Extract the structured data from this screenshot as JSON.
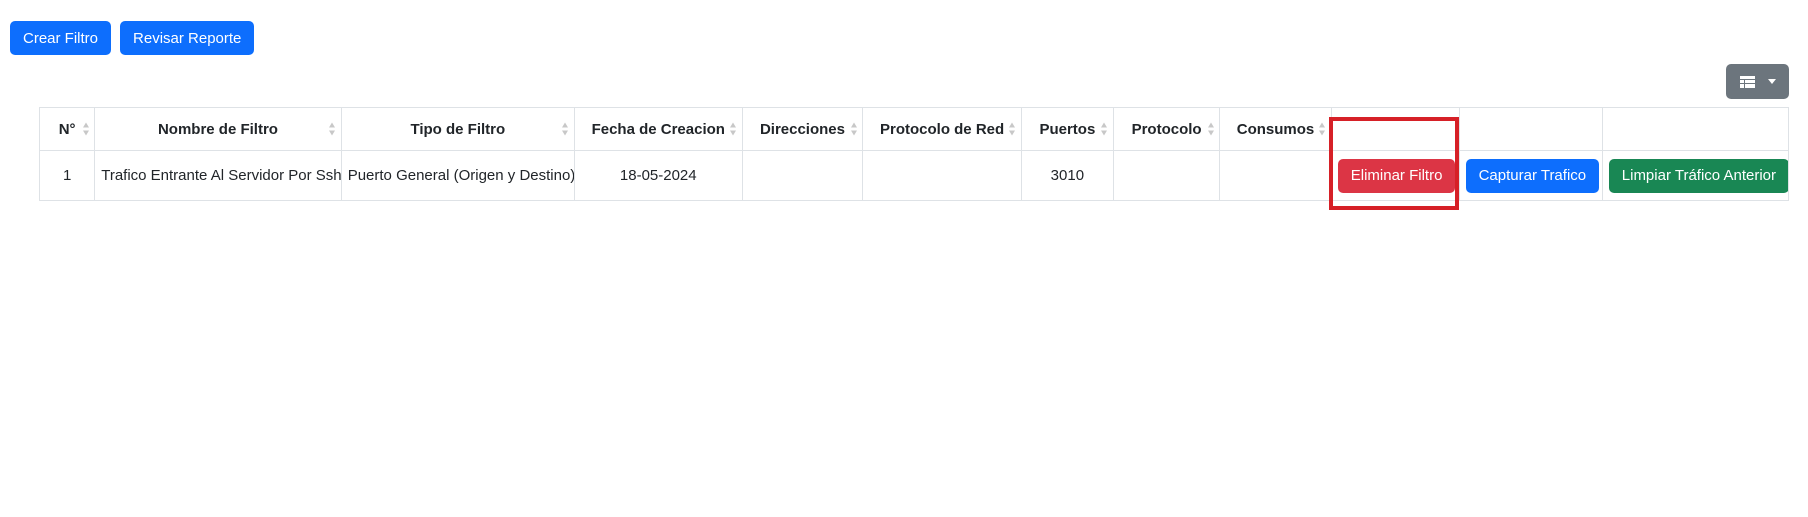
{
  "toolbar": {
    "create_filter_label": "Crear Filtro",
    "review_report_label": "Revisar Reporte"
  },
  "columns_toggle": {
    "icon": "grid-icon",
    "caret": "caret-down-icon",
    "color": "#6c757d"
  },
  "table": {
    "headers": [
      "N°",
      "Nombre de Filtro",
      "Tipo de Filtro",
      "Fecha de Creacion",
      "Direcciones",
      "Protocolo de Red",
      "Puertos",
      "Protocolo",
      "Consumos",
      "",
      "",
      ""
    ],
    "rows": [
      {
        "number": "1",
        "name": "Trafico Entrante Al Servidor Por Ssh",
        "type": "Puerto General (Origen y Destino)",
        "date": "18-05-2024",
        "addresses": "",
        "network_protocol": "",
        "ports": "3010",
        "protocol": "",
        "consumption": "",
        "delete_label": "Eliminar Filtro",
        "capture_label": "Capturar Trafico",
        "clear_label": "Limpiar Tráfico Anterior"
      }
    ]
  },
  "colors": {
    "primary": "#0d6efd",
    "danger": "#dc3545",
    "success": "#198754",
    "highlight": "#d62027"
  }
}
